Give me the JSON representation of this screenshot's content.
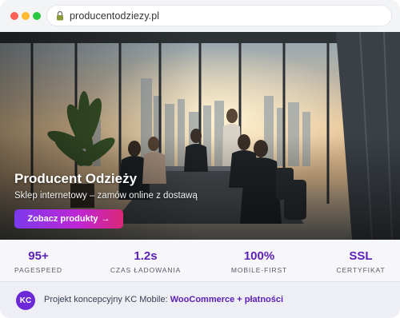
{
  "browser": {
    "url": "producentodziezy.pl",
    "lock_icon": "lock-icon",
    "window_controls": [
      "close",
      "minimize",
      "maximize"
    ]
  },
  "hero": {
    "title": "Producent Odzieży",
    "subtitle": "Sklep internetowy – zamów online z dostawą",
    "cta_label": "Zobacz produkty",
    "cta_arrow": "→",
    "cta_gradient": [
      "#7c3aed",
      "#db2777"
    ],
    "image": "business meeting in glass office overlooking city at sunset"
  },
  "stats": [
    {
      "value": "95+",
      "label": "PAGESPEED"
    },
    {
      "value": "1.2s",
      "label": "CZAS ŁADOWANIA"
    },
    {
      "value": "100%",
      "label": "MOBILE-FIRST"
    },
    {
      "value": "SSL",
      "label": "CERTYFIKAT"
    }
  ],
  "footer": {
    "avatar_initials": "KC",
    "text": "Projekt koncepcyjny KC Mobile:",
    "link_text": "WooCommerce + płatności"
  },
  "colors": {
    "accent": "#5b21b6",
    "avatar": "#6d28d9",
    "stats_bg": "#f7f7fb",
    "footer_bg": "#eeeef5"
  }
}
